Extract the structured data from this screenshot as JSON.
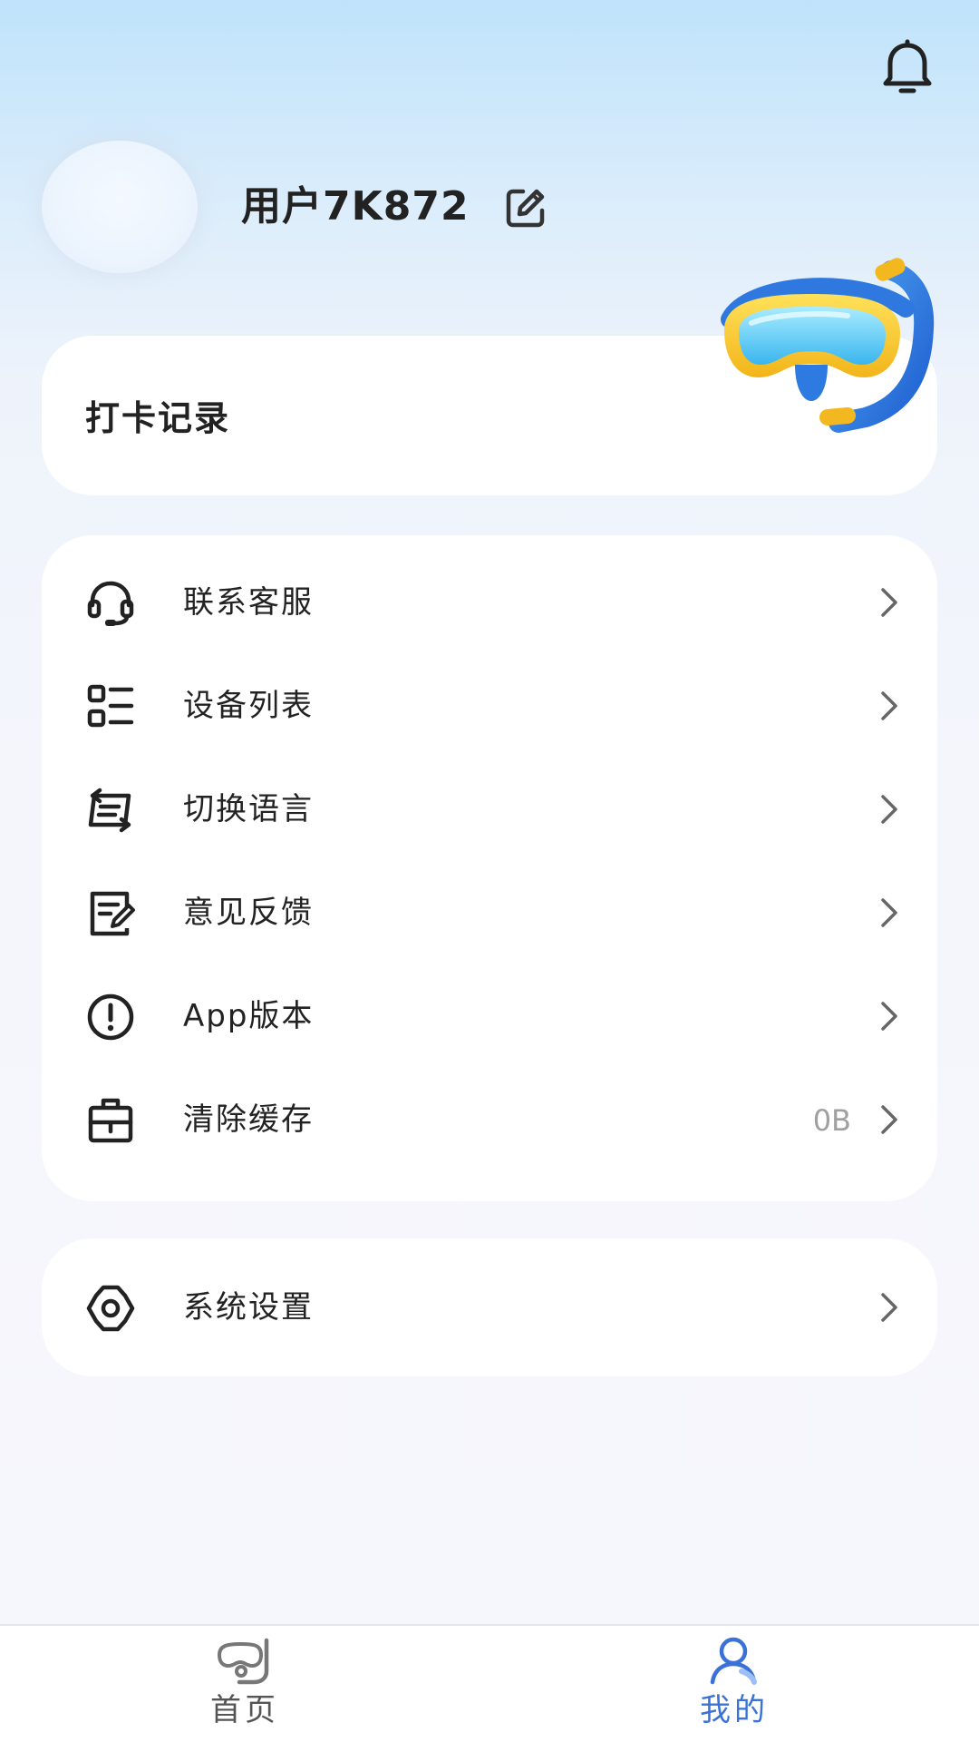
{
  "profile": {
    "username": "用户7K872"
  },
  "checkin": {
    "title": "打卡记录"
  },
  "menu": {
    "items": [
      {
        "label": "联系客服",
        "icon": "headset-icon"
      },
      {
        "label": "设备列表",
        "icon": "list-icon"
      },
      {
        "label": "切换语言",
        "icon": "language-switch-icon"
      },
      {
        "label": "意见反馈",
        "icon": "feedback-icon"
      },
      {
        "label": "App版本",
        "icon": "info-icon"
      },
      {
        "label": "清除缓存",
        "icon": "clear-cache-icon",
        "value": "0B"
      }
    ]
  },
  "settings": {
    "label": "系统设置",
    "icon": "gear-icon"
  },
  "tabbar": {
    "home_label": "首页",
    "mine_label": "我的",
    "active": "mine"
  },
  "colors": {
    "accent": "#3a72d8",
    "inactive": "#555555",
    "text": "#222222",
    "secondary": "#a0a0a0"
  }
}
